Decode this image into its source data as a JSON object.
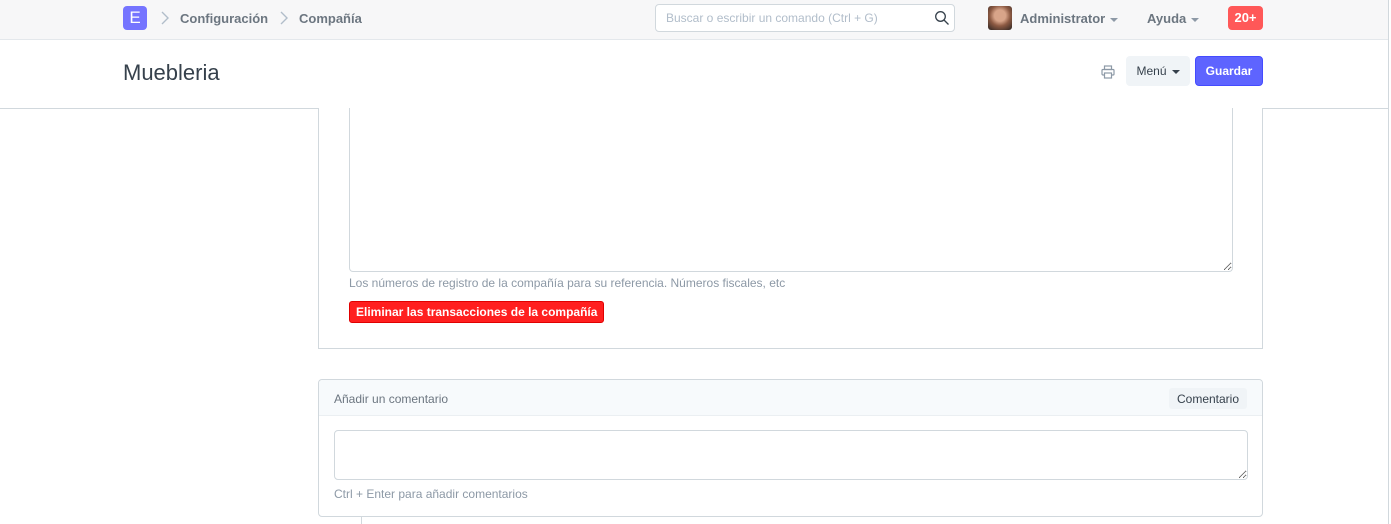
{
  "navbar": {
    "logo_letter": "E",
    "breadcrumbs": [
      {
        "label": "Configuración"
      },
      {
        "label": "Compañía"
      }
    ],
    "search": {
      "placeholder": "Buscar o escribir un comando (Ctrl + G)",
      "value": ""
    },
    "user_label": "Administrator",
    "help_label": "Ayuda",
    "notifications_count": "20+"
  },
  "page_head": {
    "title": "Muebleria",
    "menu_label": "Menú",
    "save_label": "Guardar"
  },
  "form": {
    "registration_details_value": "",
    "registration_help_text": "Los números de registro de la compañía para su referencia. Números fiscales, etc",
    "delete_transactions_label": "Eliminar las transacciones de la compañía"
  },
  "comments": {
    "title": "Añadir un comentario",
    "button_label": "Comentario",
    "input_value": "",
    "hint": "Ctrl + Enter para añadir comentarios"
  },
  "colors": {
    "brand": "#7574ff",
    "primary_button": "#5e64ff",
    "danger_button": "#ff1f1f",
    "notification_badge": "#ff5858"
  },
  "icons": [
    "app-logo-icon",
    "chevron-right-icon",
    "search-icon",
    "caret-down-icon",
    "printer-icon"
  ]
}
